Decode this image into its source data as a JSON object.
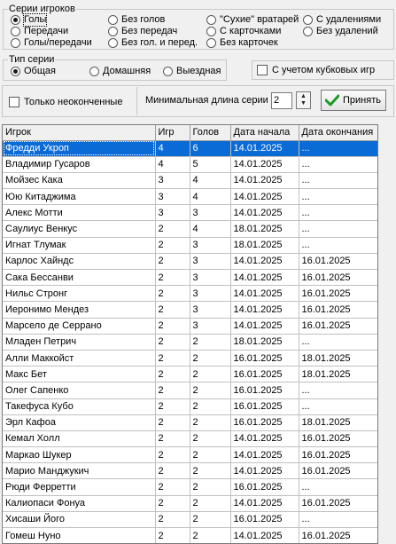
{
  "series_group": {
    "legend": "Серии игроков",
    "options": [
      {
        "label": "Голы",
        "checked": true
      },
      {
        "label": "Без голов",
        "checked": false
      },
      {
        "label": "\"Сухие\" вратарей",
        "checked": false
      },
      {
        "label": "С удалениями",
        "checked": false
      },
      {
        "label": "Передачи",
        "checked": false
      },
      {
        "label": "Без передач",
        "checked": false
      },
      {
        "label": "С карточками",
        "checked": false
      },
      {
        "label": "Без удалений",
        "checked": false
      },
      {
        "label": "Голы/передачи",
        "checked": false
      },
      {
        "label": "Без гол. и перед.",
        "checked": false
      },
      {
        "label": "Без карточек",
        "checked": false
      }
    ]
  },
  "type_group": {
    "legend": "Тип серии",
    "options": [
      {
        "label": "Общая",
        "checked": true
      },
      {
        "label": "Домашняя",
        "checked": false
      },
      {
        "label": "Выездная",
        "checked": false
      }
    ]
  },
  "cup_games_label": "С учетом кубковых игр",
  "unfinished_label": "Только неоконченные",
  "min_length_label": "Минимальная длина серии",
  "min_length_value": "2",
  "accept_label": "Принять",
  "table": {
    "headers": [
      "Игрок",
      "Игр",
      "Голов",
      "Дата начала",
      "Дата окончания"
    ],
    "selected_row": 0,
    "rows": [
      [
        "Фредди Укроп",
        "4",
        "6",
        "14.01.2025",
        "..."
      ],
      [
        "Владимир Гусаров",
        "4",
        "5",
        "14.01.2025",
        "..."
      ],
      [
        "Мойзес Кака",
        "3",
        "4",
        "14.01.2025",
        "..."
      ],
      [
        "Юю Китаджима",
        "3",
        "4",
        "14.01.2025",
        "..."
      ],
      [
        "Алекс Мотти",
        "3",
        "3",
        "14.01.2025",
        "..."
      ],
      [
        "Саулиус Венкус",
        "2",
        "4",
        "18.01.2025",
        "..."
      ],
      [
        "Игнат Тлумак",
        "2",
        "3",
        "18.01.2025",
        "..."
      ],
      [
        "Карлос Хайндс",
        "2",
        "3",
        "14.01.2025",
        "16.01.2025"
      ],
      [
        "Сака Бессанви",
        "2",
        "3",
        "14.01.2025",
        "16.01.2025"
      ],
      [
        "Нильс Стронг",
        "2",
        "3",
        "14.01.2025",
        "16.01.2025"
      ],
      [
        "Иеронимо Мендез",
        "2",
        "3",
        "14.01.2025",
        "16.01.2025"
      ],
      [
        "Марсело де Серрано",
        "2",
        "3",
        "14.01.2025",
        "16.01.2025"
      ],
      [
        "Младен Петрич",
        "2",
        "2",
        "18.01.2025",
        "..."
      ],
      [
        "Алли Маккойст",
        "2",
        "2",
        "16.01.2025",
        "18.01.2025"
      ],
      [
        "Макс Бет",
        "2",
        "2",
        "16.01.2025",
        "18.01.2025"
      ],
      [
        "Олег Сапенко",
        "2",
        "2",
        "16.01.2025",
        "..."
      ],
      [
        "Такефуса Кубо",
        "2",
        "2",
        "16.01.2025",
        "..."
      ],
      [
        "Эрл Кафоа",
        "2",
        "2",
        "16.01.2025",
        "18.01.2025"
      ],
      [
        "Кемал Холл",
        "2",
        "2",
        "14.01.2025",
        "16.01.2025"
      ],
      [
        "Маркао Шукер",
        "2",
        "2",
        "14.01.2025",
        "16.01.2025"
      ],
      [
        "Марио Манджукич",
        "2",
        "2",
        "14.01.2025",
        "16.01.2025"
      ],
      [
        "Рюди Ферретти",
        "2",
        "2",
        "16.01.2025",
        "..."
      ],
      [
        "Калиопаси Фонуа",
        "2",
        "2",
        "14.01.2025",
        "16.01.2025"
      ],
      [
        "Хисаши Його",
        "2",
        "2",
        "16.01.2025",
        "..."
      ],
      [
        "Гомеш Нуно",
        "2",
        "2",
        "14.01.2025",
        "16.01.2025"
      ]
    ]
  }
}
